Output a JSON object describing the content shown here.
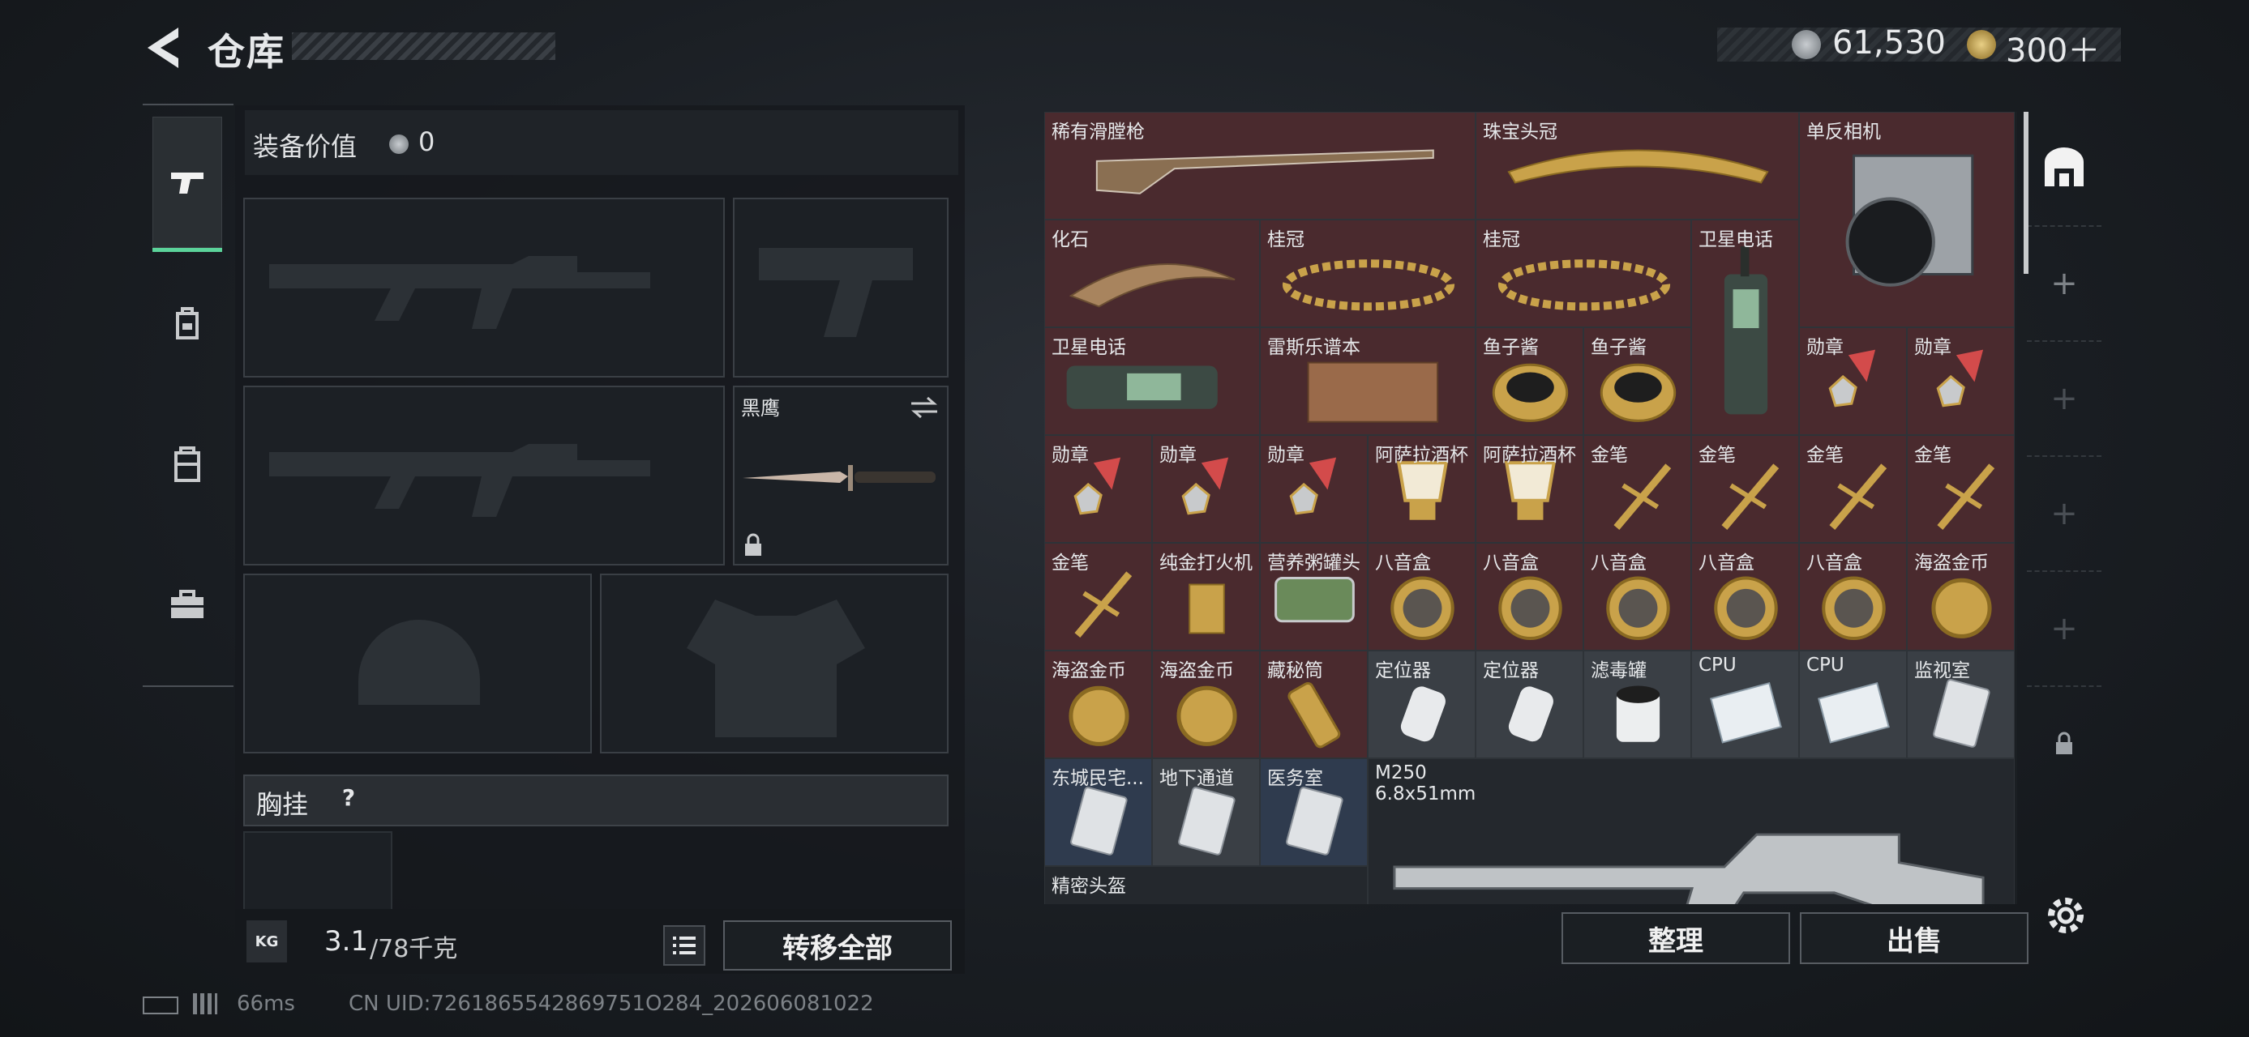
{
  "header": {
    "title": "仓库"
  },
  "currency": {
    "silver": "61,530",
    "gold": "300＋"
  },
  "left_tabs": [
    {
      "name": "weapons",
      "icon": "pistol-icon",
      "active": true
    },
    {
      "name": "gear",
      "icon": "backpack-icon",
      "active": false
    },
    {
      "name": "containers",
      "icon": "case-icon",
      "active": false
    },
    {
      "name": "toolbox",
      "icon": "toolbox-icon",
      "active": false
    }
  ],
  "loadout": {
    "value_label": "装备价值",
    "value": "0",
    "melee_name": "黑鹰",
    "chest_rig_label": "胸挂",
    "help_mark": "?",
    "weight_current": "3.1",
    "weight_max": "/78千克",
    "weight_badge": "KG",
    "transfer_all": "转移全部"
  },
  "stash_cells": [
    {
      "label": "稀有滑膛枪",
      "icon": "musket-icon",
      "bg": "#4a2a2e"
    },
    {
      "label": "珠宝头冠",
      "icon": "tiara-icon",
      "bg": "#4a2a2e"
    },
    {
      "label": "单反相机",
      "icon": "camera-icon",
      "bg": "#4a2a2e"
    },
    {
      "label": "化石",
      "icon": "fossil-claw-icon",
      "bg": "#4a2a2e"
    },
    {
      "label": "桂冠",
      "icon": "laurel-crown-icon",
      "bg": "#4a2a2e"
    },
    {
      "label": "桂冠",
      "icon": "laurel-crown-icon",
      "bg": "#4a2a2e"
    },
    {
      "label": "卫星电话",
      "icon": "sat-phone-icon",
      "bg": "#4a2a2e"
    },
    {
      "label": "卫星电话",
      "icon": "sat-phone-icon",
      "bg": "#4a2a2e"
    },
    {
      "label": "雷斯乐谱本",
      "icon": "music-book-icon",
      "bg": "#4a2a2e"
    },
    {
      "label": "鱼子酱",
      "icon": "caviar-icon",
      "bg": "#4a2a2e"
    },
    {
      "label": "鱼子酱",
      "icon": "caviar-icon",
      "bg": "#4a2a2e"
    },
    {
      "label": "勋章",
      "icon": "medal-icon",
      "bg": "#4a2a2e"
    },
    {
      "label": "勋章",
      "icon": "medal-icon",
      "bg": "#4a2a2e"
    },
    {
      "label": "勋章",
      "icon": "medal-icon",
      "bg": "#4a2a2e"
    },
    {
      "label": "勋章",
      "icon": "medal-icon",
      "bg": "#4a2a2e"
    },
    {
      "label": "勋章",
      "icon": "medal-icon",
      "bg": "#4a2a2e"
    },
    {
      "label": "阿萨拉酒杯",
      "icon": "chalice-icon",
      "bg": "#4a2a2e"
    },
    {
      "label": "阿萨拉酒杯",
      "icon": "chalice-icon",
      "bg": "#4a2a2e"
    },
    {
      "label": "金笔",
      "icon": "gold-pen-icon",
      "bg": "#4a2a2e"
    },
    {
      "label": "金笔",
      "icon": "gold-pen-icon",
      "bg": "#4a2a2e"
    },
    {
      "label": "金笔",
      "icon": "gold-pen-icon",
      "bg": "#4a2a2e"
    },
    {
      "label": "金笔",
      "icon": "gold-pen-icon",
      "bg": "#4a2a2e"
    },
    {
      "label": "金笔",
      "icon": "gold-pen-icon",
      "bg": "#4a2a2e"
    },
    {
      "label": "纯金打火机",
      "icon": "lighter-icon",
      "bg": "#4a2a2e"
    },
    {
      "label": "营养粥罐头",
      "icon": "tin-can-icon",
      "bg": "#4a2a2e"
    },
    {
      "label": "八音盒",
      "icon": "music-box-icon",
      "bg": "#4a2a2e"
    },
    {
      "label": "八音盒",
      "icon": "music-box-icon",
      "bg": "#4a2a2e"
    },
    {
      "label": "八音盒",
      "icon": "music-box-icon",
      "bg": "#4a2a2e"
    },
    {
      "label": "八音盒",
      "icon": "music-box-icon",
      "bg": "#4a2a2e"
    },
    {
      "label": "八音盒",
      "icon": "music-box-icon",
      "bg": "#4a2a2e"
    },
    {
      "label": "海盗金币",
      "icon": "pirate-coin-icon",
      "bg": "#4a2a2e"
    },
    {
      "label": "海盗金币",
      "icon": "pirate-coin-icon",
      "bg": "#4a2a2e"
    },
    {
      "label": "海盗金币",
      "icon": "pirate-coin-icon",
      "bg": "#4a2a2e"
    },
    {
      "label": "藏秘筒",
      "icon": "cryptex-icon",
      "bg": "#4a2a2e"
    },
    {
      "label": "定位器",
      "icon": "tracker-icon",
      "bg": "#3a3f45"
    },
    {
      "label": "定位器",
      "icon": "tracker-icon",
      "bg": "#3a3f45"
    },
    {
      "label": "滤毒罐",
      "icon": "filter-canister-icon",
      "bg": "#3a3f45"
    },
    {
      "label": "CPU",
      "icon": "cpu-icon",
      "bg": "#3a3f45"
    },
    {
      "label": "CPU",
      "icon": "cpu-icon",
      "bg": "#3a3f45"
    },
    {
      "label": "监视室",
      "icon": "keycard-icon",
      "bg": "#3a3f45"
    },
    {
      "label": "东城民宅...",
      "icon": "keycard-icon",
      "bg": "#2f3b4e"
    },
    {
      "label": "地下通道",
      "icon": "keycard-icon",
      "bg": "#3a3f45"
    },
    {
      "label": "医务室",
      "icon": "keycard-icon",
      "bg": "#2f3b4e"
    },
    {
      "label": "M250",
      "sub": "6.8x51mm",
      "icon": "machine-gun-icon",
      "bg": "#24282d"
    },
    {
      "label": "精密头盔",
      "icon": "helmet-icon",
      "bg": "#24282d"
    }
  ],
  "actions": {
    "sort": "整理",
    "sell": "出售"
  },
  "footer": {
    "ping": "66ms",
    "uid": "CN UID:7261865542869751O284_202606081022"
  }
}
